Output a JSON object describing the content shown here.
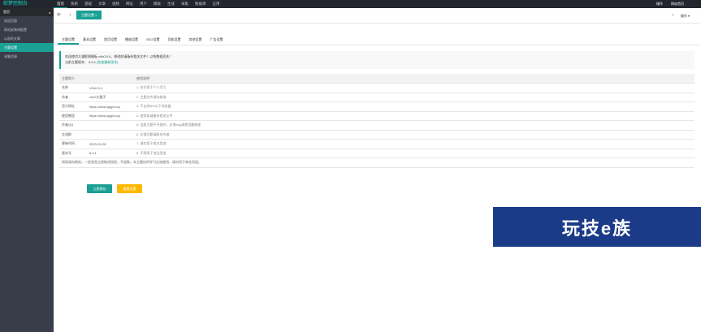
{
  "topbar": {
    "logo": "织梦控制台",
    "nav": [
      "首页",
      "系统",
      "基础",
      "文章",
      "视频",
      "网址",
      "用户",
      "模板",
      "生成",
      "采集",
      "数据库",
      "应用"
    ],
    "active_index": 0,
    "right": [
      "操作",
      "网站首页"
    ]
  },
  "sidebar": {
    "title": "首页",
    "items": [
      "欢迎页面",
      "网站安装体配置",
      "以前的文章",
      "主题设置",
      "采集资源"
    ],
    "active_index": 3
  },
  "tabs": {
    "active_label": "主题设置",
    "ops_label": "操作"
  },
  "subtabs": [
    "主题设置",
    "基本设置",
    "首页设置",
    "播放设置",
    "SEO设置",
    "导航设置",
    "其他设置",
    "广告设置"
  ],
  "notice": {
    "line1": "欢迎使用大潘影视模板 v9v0 5.0，修改前请备份相关文件！以免数据丢失！",
    "line2_prefix": "当前主题版本：",
    "version": "5.0.1",
    "update_link": "[检查最新版本]"
  },
  "table": {
    "headers": [
      "主题简介",
      "",
      "使用说明"
    ],
    "rows": [
      {
        "k": "名称",
        "v": "V9v0 5.0",
        "d": "1. 仅许用于个人学习"
      },
      {
        "k": "作者",
        "v": "v9v0大猫子",
        "d": "2. 主题文件请勿修改"
      },
      {
        "k": "官方网址",
        "v": "https://www.qiqpx.top",
        "d": "3. 不支持IE9以下浏览器"
      },
      {
        "k": "使用教程",
        "v": "https://www.qiqpx.top",
        "d": "4. 使用前请备份相关文件"
      },
      {
        "k": "作者QQ",
        "v": "",
        "d": "5. 旧版主题不予维护，反馈bug请使用最新版"
      },
      {
        "k": "交流群",
        "v": "",
        "d": "6. 反馈问题请联系作者"
      },
      {
        "k": "更新时间",
        "v": "2023-09-28",
        "d": "7. 请勿用于商业用途"
      },
      {
        "k": "版本号",
        "v": "5.0.1",
        "d": "8. 不得用于违法用途"
      }
    ],
    "footer": "授权请勿倒卖，一经发现立即取消授权，不退款。本主题仅供学习交流使用，请勿用于商业用途。"
  },
  "buttons": {
    "save": "立即保存",
    "reset": "重置设置"
  },
  "watermark": "玩技e族"
}
